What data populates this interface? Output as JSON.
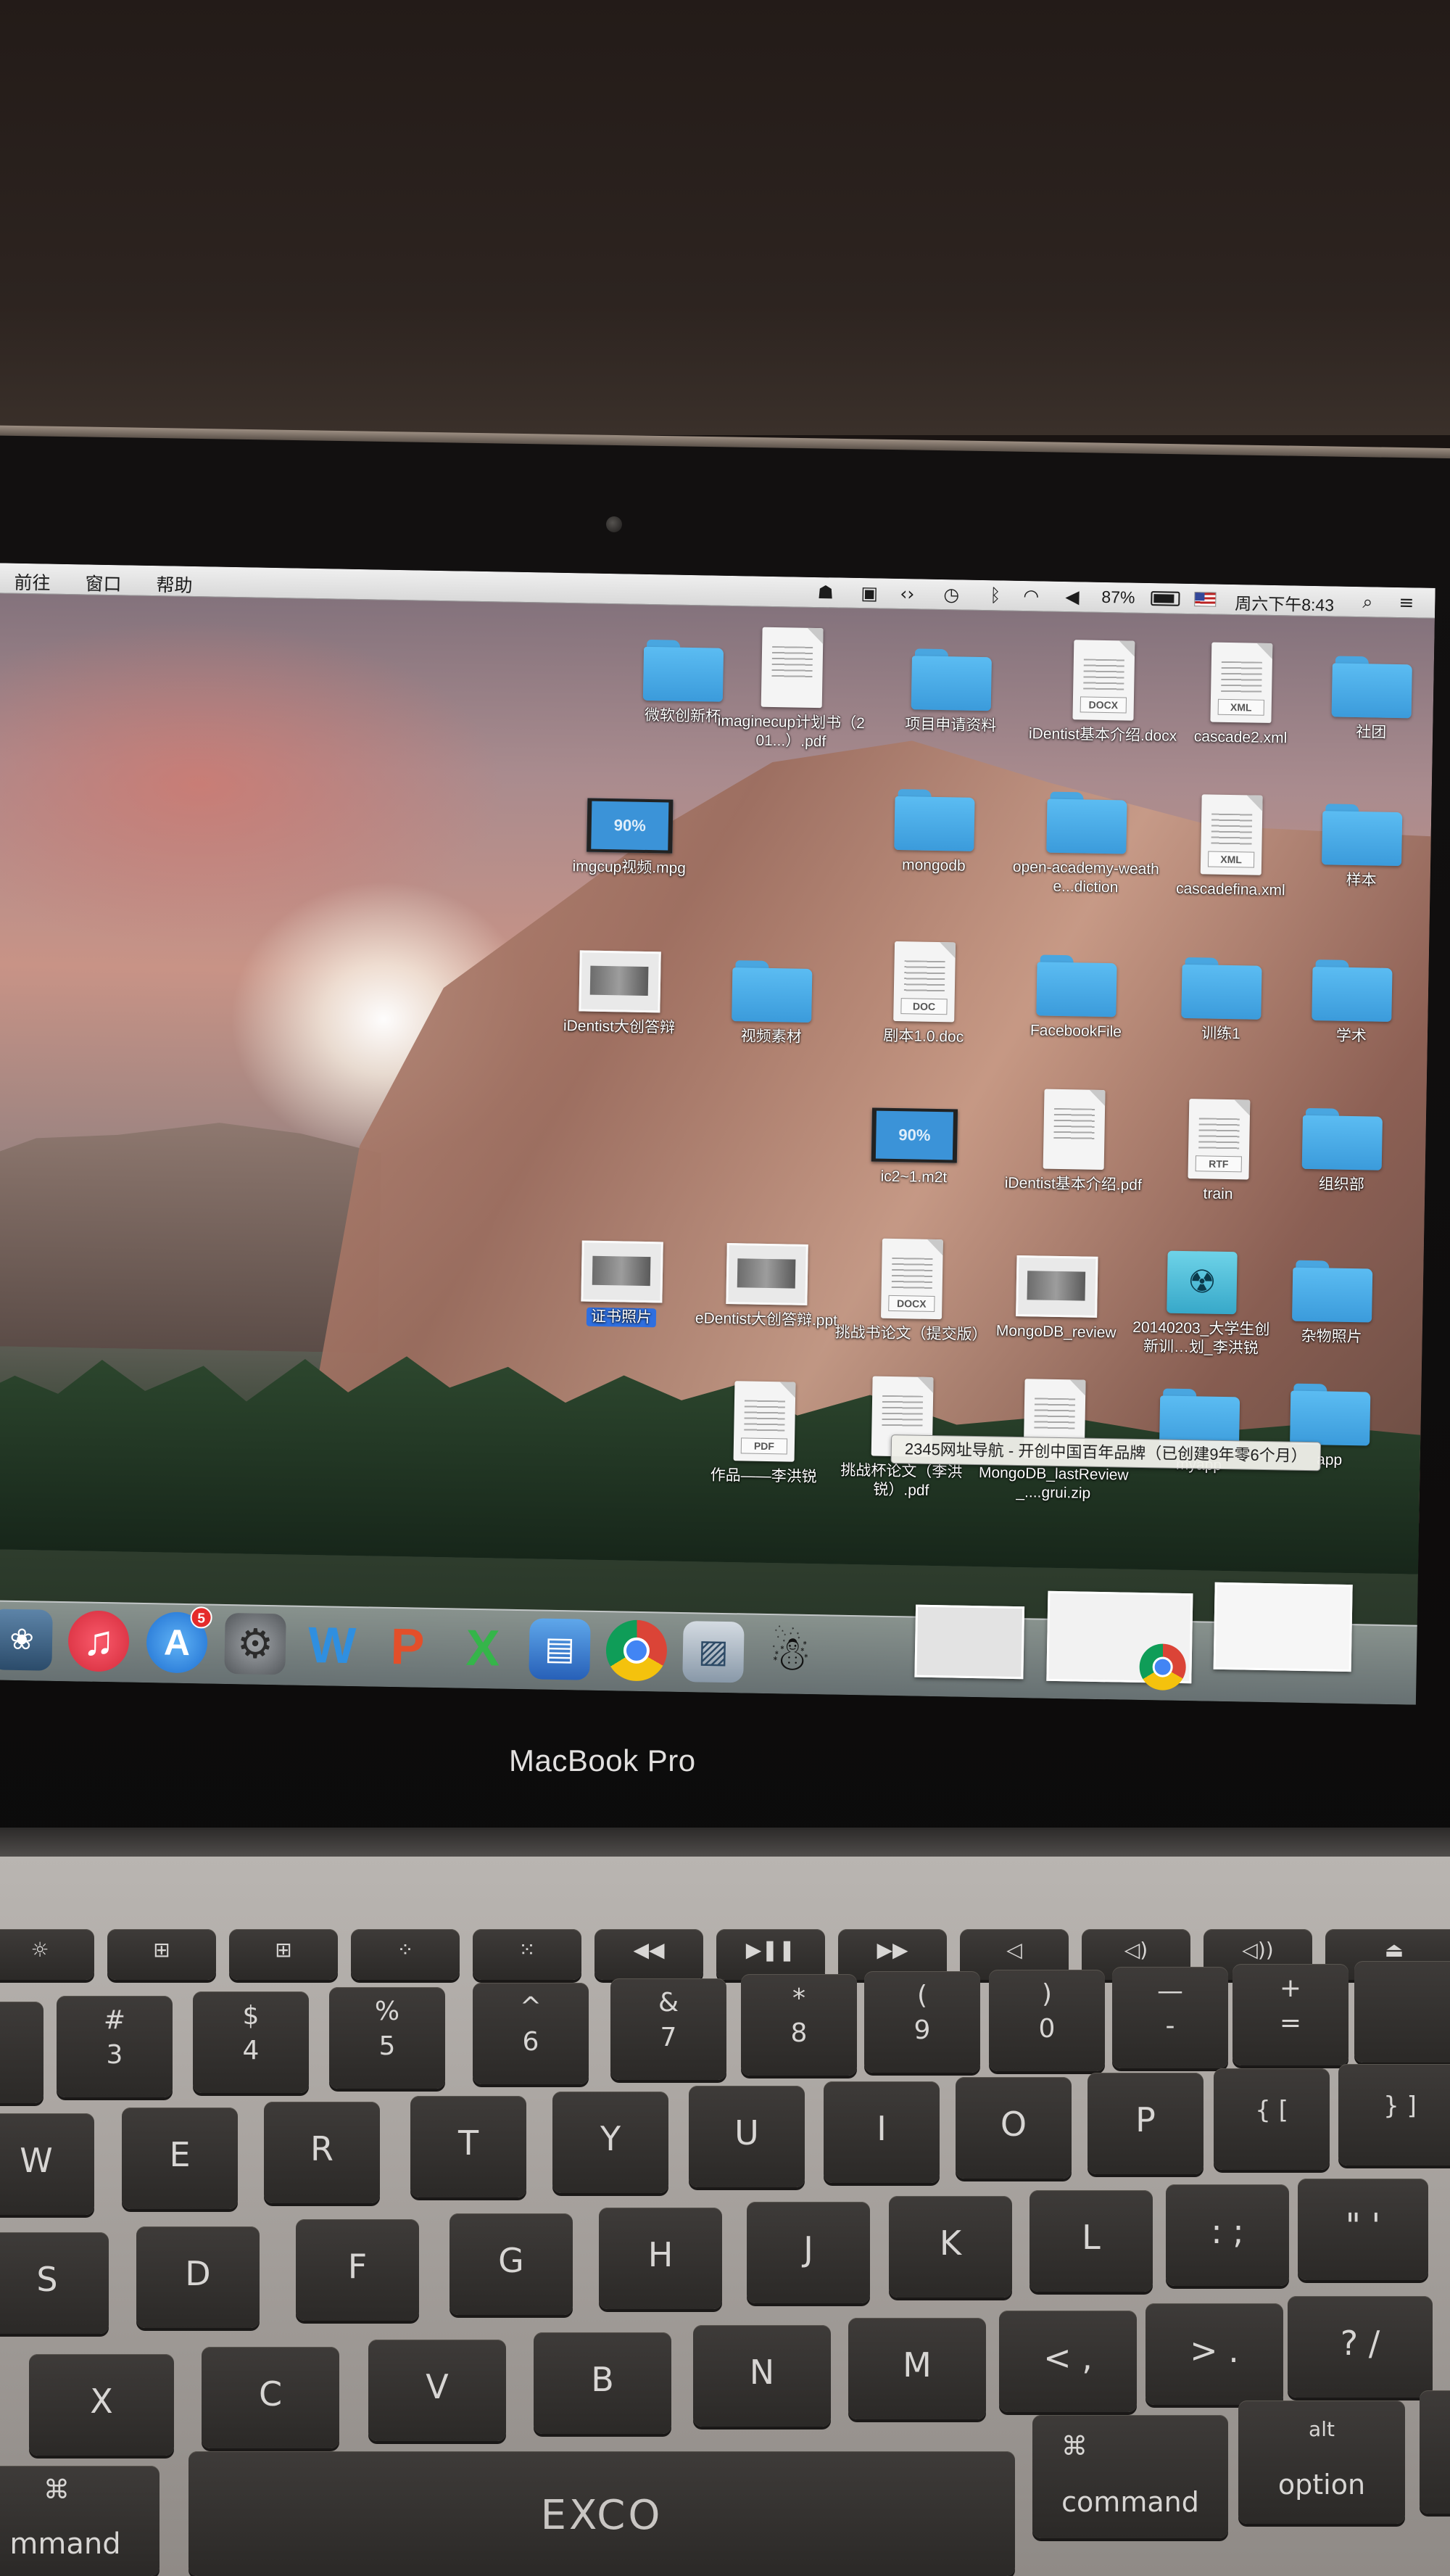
{
  "menubar": {
    "menus": [
      "前往",
      "窗口",
      "帮助"
    ],
    "battery": "87%",
    "clock": "周六下午8:43"
  },
  "desktop": {
    "items": [
      {
        "label": "微软创新杯",
        "type": "folder"
      },
      {
        "label": "imaginecup计划书（201...）.pdf",
        "type": "pdf"
      },
      {
        "label": "项目申请资料",
        "type": "folder"
      },
      {
        "label": "iDentist基本介绍.docx",
        "type": "docx",
        "kind": "DOCX"
      },
      {
        "label": "cascade2.xml",
        "type": "xml",
        "kind": "XML"
      },
      {
        "label": "社团",
        "type": "folder"
      },
      {
        "label": "imgcup视频.mpg",
        "type": "video",
        "progress": "90%"
      },
      {
        "label": "mongodb",
        "type": "folder"
      },
      {
        "label": "open-academy-weathe...diction",
        "type": "folder"
      },
      {
        "label": "cascadefina.xml",
        "type": "xml",
        "kind": "XML"
      },
      {
        "label": "样本",
        "type": "folder"
      },
      {
        "label": "iDentist大创答辩",
        "type": "thumb"
      },
      {
        "label": "视频素材",
        "type": "folder"
      },
      {
        "label": "剧本1.0.doc",
        "type": "doc",
        "kind": "DOC"
      },
      {
        "label": "FacebookFile",
        "type": "folder"
      },
      {
        "label": "训练1",
        "type": "folder"
      },
      {
        "label": "学术",
        "type": "folder"
      },
      {
        "label": "ic2~1.m2t",
        "type": "video",
        "progress": "90%"
      },
      {
        "label": "iDentist基本介绍.pdf",
        "type": "pdf"
      },
      {
        "label": "train",
        "type": "rtf",
        "kind": "RTF"
      },
      {
        "label": "组织部",
        "type": "folder"
      },
      {
        "label": "证书照片",
        "type": "thumb",
        "selected": true
      },
      {
        "label": "eDentist大创答辩.ppt",
        "type": "thumb"
      },
      {
        "label": "挑战书论文（提交版）",
        "type": "docx",
        "kind": "DOCX"
      },
      {
        "label": "MongoDB_review",
        "type": "thumb"
      },
      {
        "label": "20140203_大学生创新训…划_李洪锐",
        "type": "radio"
      },
      {
        "label": "杂物照片",
        "type": "folder"
      },
      {
        "label": "作品——李洪锐",
        "type": "pdf",
        "kind": "PDF"
      },
      {
        "label": "挑战杯论文（李洪锐）.pdf",
        "type": "pdf"
      },
      {
        "label": "MongoDB_lastReview_....grui.zip",
        "type": "zip"
      },
      {
        "label": "myapp",
        "type": "folder"
      },
      {
        "label": "app",
        "type": "folder"
      }
    ]
  },
  "tooltip": "2345网址导航 - 开创中国百年品牌（已创建9年零6个月）",
  "dock": {
    "apps": [
      "iPhoto",
      "iTunes",
      "App Store",
      "System Preferences",
      "Word",
      "PowerPoint",
      "Excel",
      "Keynote",
      "Chrome",
      "Preview",
      "QQ"
    ],
    "app_store_badge": "5"
  },
  "laptop": {
    "brand": "MacBook Pro",
    "keyboard_logo": "EXCO"
  },
  "keyboard": {
    "number_row": [
      {
        "top": "#",
        "bottom": "3"
      },
      {
        "top": "$",
        "bottom": "4"
      },
      {
        "top": "%",
        "bottom": "5"
      },
      {
        "top": "^",
        "bottom": "6"
      },
      {
        "top": "&",
        "bottom": "7"
      },
      {
        "top": "*",
        "bottom": "8"
      },
      {
        "top": "(",
        "bottom": "9"
      },
      {
        "top": ")",
        "bottom": "0"
      },
      {
        "top": "—",
        "bottom": "-"
      },
      {
        "top": "+",
        "bottom": "="
      }
    ],
    "row_q": [
      "W",
      "E",
      "R",
      "T",
      "Y",
      "U",
      "I",
      "O",
      "P",
      "{ [",
      "} ]"
    ],
    "row_a": [
      "S",
      "D",
      "F",
      "G",
      "H",
      "J",
      "K",
      "L",
      ": ;",
      "\" '"
    ],
    "row_z": [
      "X",
      "C",
      "V",
      "B",
      "N",
      "M",
      "< ,",
      "> .",
      "? /"
    ],
    "command_label": "command",
    "option_label": "option",
    "alt_label": "alt",
    "command_symbol": "⌘",
    "left_command_label": "mmand"
  }
}
